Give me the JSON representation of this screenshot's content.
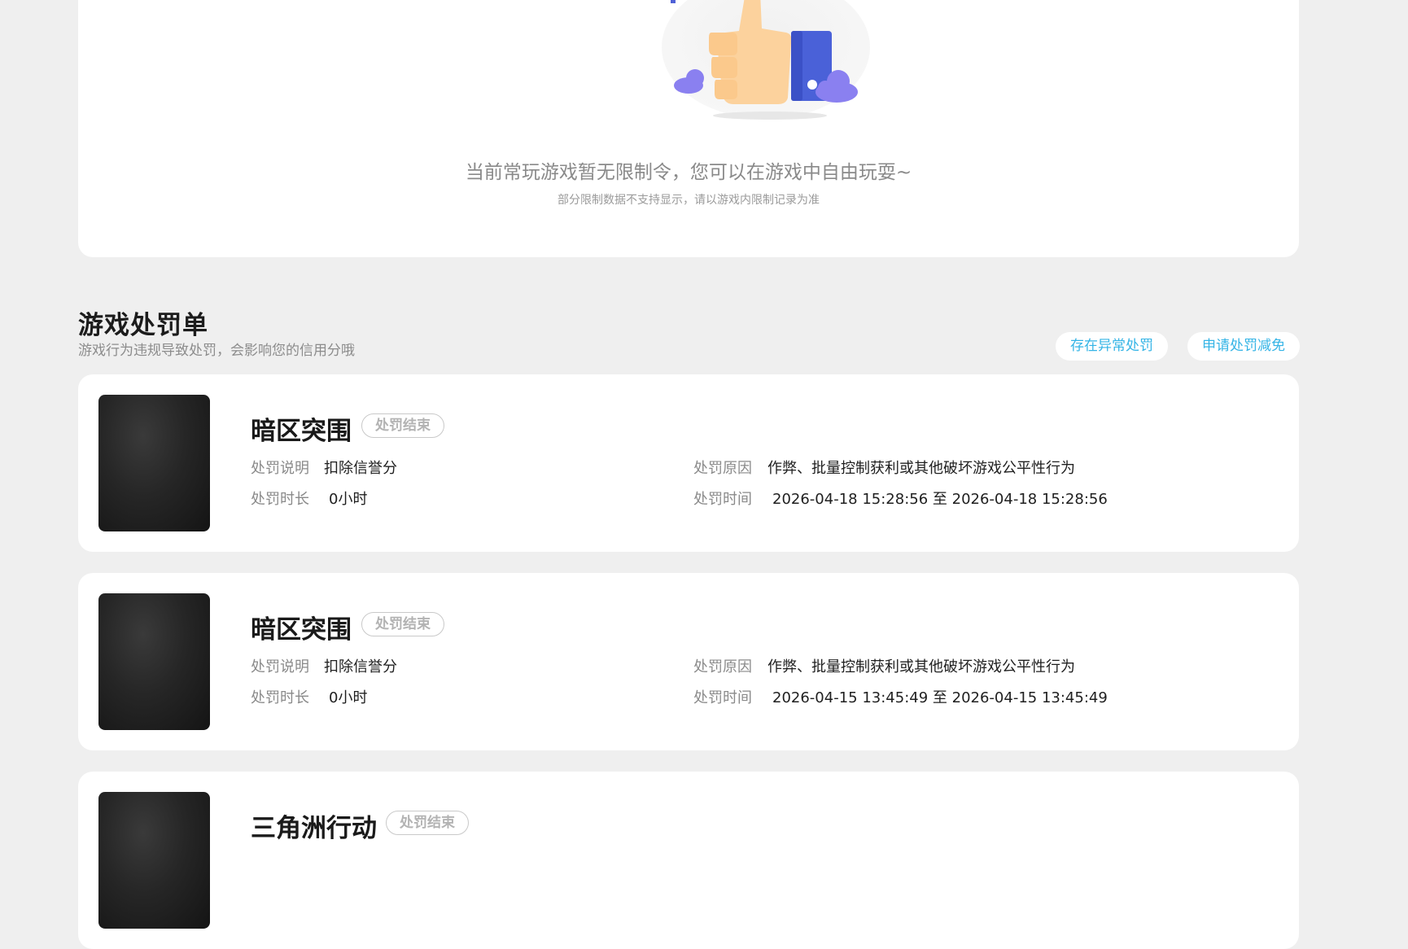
{
  "empty_state": {
    "message": "当前常玩游戏暂无限制令，您可以在游戏中自由玩耍~",
    "note": "部分限制数据不支持显示，请以游戏内限制记录为准"
  },
  "section": {
    "title": "游戏处罚单",
    "subtitle": "游戏行为违规导致处罚，会影响您的信用分哦",
    "actions": [
      "存在异常处罚",
      "申请处罚减免"
    ]
  },
  "labels": {
    "desc": "处罚说明",
    "duration": "处罚时长",
    "reason": "处罚原因",
    "time": "处罚时间"
  },
  "penalties": [
    {
      "game": "暗区突围",
      "status": "处罚结束",
      "desc": "扣除信誉分",
      "duration": "0小时",
      "reason": "作弊、批量控制获利或其他破坏游戏公平性行为",
      "time": "2026-04-18 15:28:56 至 2026-04-18 15:28:56"
    },
    {
      "game": "暗区突围",
      "status": "处罚结束",
      "desc": "扣除信誉分",
      "duration": "0小时",
      "reason": "作弊、批量控制获利或其他破坏游戏公平性行为",
      "time": "2026-04-15 13:45:49 至 2026-04-15 13:45:49"
    },
    {
      "game": "三角洲行动",
      "status": "处罚结束"
    }
  ],
  "colors": {
    "accent": "#34b4e6",
    "page_bg": "#efefef"
  }
}
